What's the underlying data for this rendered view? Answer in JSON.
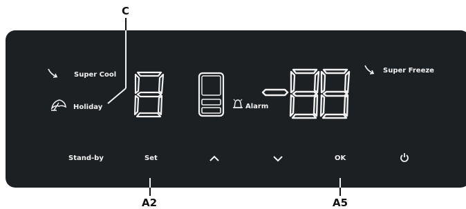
{
  "callouts": {
    "c": "C",
    "a2": "A2",
    "a5": "A5"
  },
  "labels": {
    "super_cool": "Super Cool",
    "holiday": "Holiday",
    "alarm": "Alarm",
    "super_freeze": "Super Freeze"
  },
  "buttons": {
    "standby": "Stand-by",
    "set": "Set",
    "ok": "OK"
  },
  "displays": {
    "fridge_digit": "8",
    "freezer_digits": "-88"
  },
  "icons": {
    "super_cool": "arrow-down-right-icon",
    "holiday": "umbrella-icon",
    "compartment": "fridge-compartments-icon",
    "alarm": "bell-icon",
    "super_freeze": "arrow-down-right-icon",
    "up": "chevron-up-icon",
    "down": "chevron-down-icon",
    "power": "power-icon"
  },
  "colors": {
    "panel": "#1d2023",
    "text": "#f2f2f2",
    "callout": "#111111"
  }
}
